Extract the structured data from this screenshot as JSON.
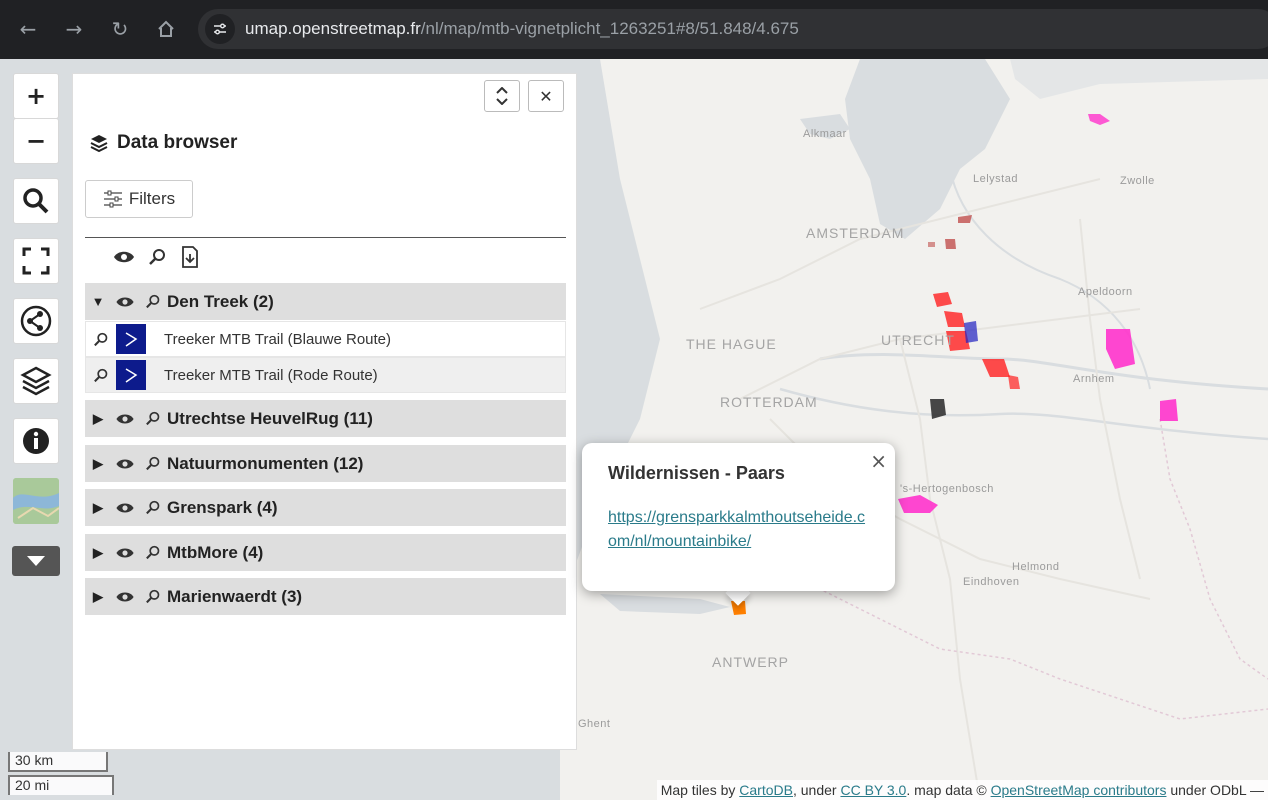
{
  "browser": {
    "url_host": "umap.openstreetmap.fr",
    "url_path": "/nl/map/mtb-vignetplicht_1263251#8/51.848/4.675"
  },
  "map": {
    "cities": [
      {
        "name": "Alkmaar",
        "big": false
      },
      {
        "name": "Lelystad",
        "big": false
      },
      {
        "name": "Zwolle",
        "big": false
      },
      {
        "name": "AMSTERDAM",
        "big": true
      },
      {
        "name": "Apeldoorn",
        "big": false
      },
      {
        "name": "THE HAGUE",
        "big": true
      },
      {
        "name": "UTRECHT",
        "big": true
      },
      {
        "name": "Arnhem",
        "big": false
      },
      {
        "name": "ROTTERDAM",
        "big": true
      },
      {
        "name": "'s-Hertogenbosch",
        "big": false
      },
      {
        "name": "Helmond",
        "big": false
      },
      {
        "name": "Eindhoven",
        "big": false
      },
      {
        "name": "ANTWERP",
        "big": true
      },
      {
        "name": "Ghent",
        "big": false
      }
    ]
  },
  "controls": {
    "zoom_in": "+",
    "zoom_out": "−"
  },
  "panel": {
    "title": "Data browser",
    "filters_label": "Filters",
    "layers": [
      {
        "label": "Den Treek (2)",
        "expanded": true
      },
      {
        "label": "Utrechtse HeuvelRug (11)",
        "expanded": false
      },
      {
        "label": "Natuurmonumenten (12)",
        "expanded": false
      },
      {
        "label": "Grenspark (4)",
        "expanded": false
      },
      {
        "label": "MtbMore (4)",
        "expanded": false
      },
      {
        "label": "Marienwaerdt (3)",
        "expanded": false
      }
    ],
    "features": [
      {
        "label": "Treeker MTB Trail (Blauwe Route)"
      },
      {
        "label": "Treeker MTB Trail (Rode Route)"
      }
    ]
  },
  "popup": {
    "title": "Wildernissen - Paars",
    "link": "https://grensparkkalmthoutseheide.com/nl/mountainbike/"
  },
  "scale": {
    "km": "30 km",
    "mi": "20 mi"
  },
  "attribution": {
    "prefix": "Map tiles by ",
    "cartodb": "CartoDB",
    "under1": ", under ",
    "ccby": "CC BY 3.0",
    "mapdata": ". map data © ",
    "osm": "OpenStreetMap contributors",
    "suffix": " under ODbL —"
  },
  "colors": {
    "accent_link": "#2a7b8a",
    "feature_icon_bg": "#0d1b8c"
  }
}
